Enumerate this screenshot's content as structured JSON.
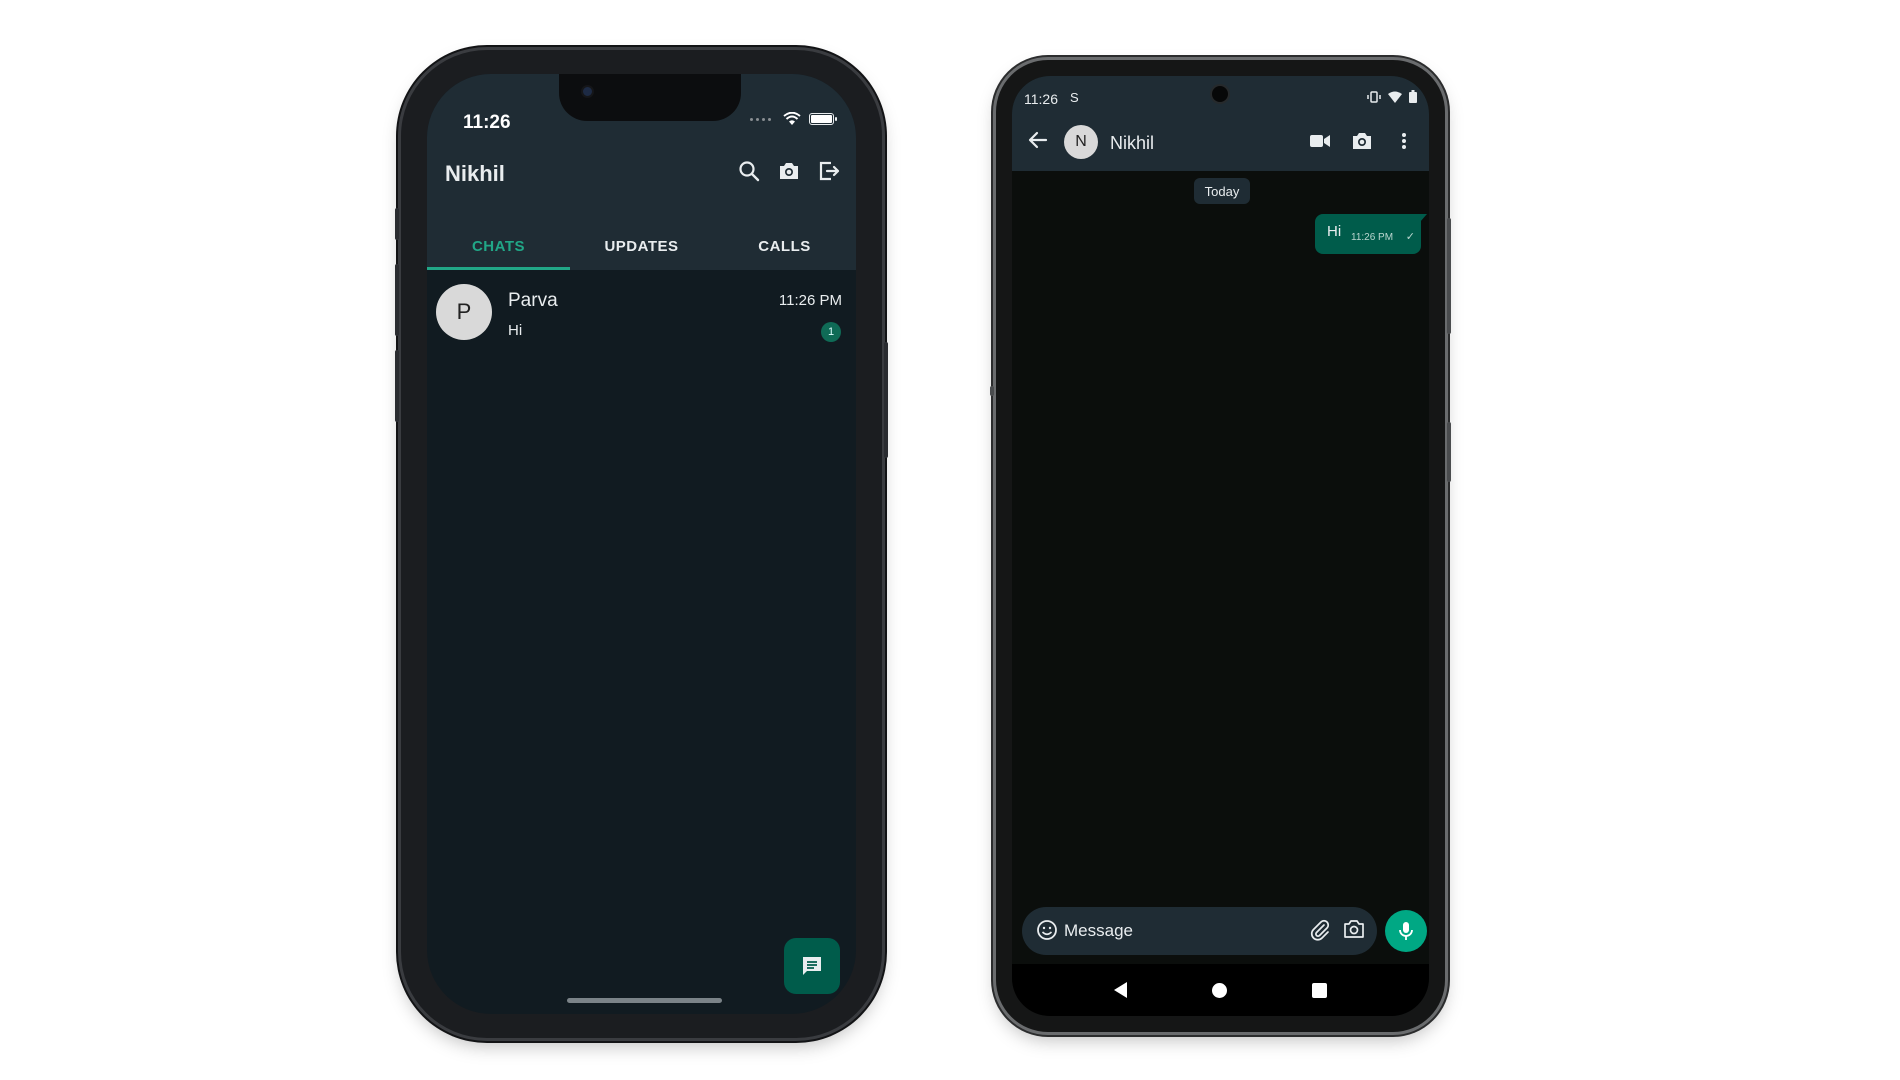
{
  "ios": {
    "status_time": "11:26",
    "title": "Nikhil",
    "tabs": [
      {
        "label": "CHATS"
      },
      {
        "label": "UPDATES"
      },
      {
        "label": "CALLS"
      }
    ],
    "chats": [
      {
        "avatar_letter": "P",
        "name": "Parva",
        "last_message": "Hi",
        "time": "11:26 PM",
        "unread": "1"
      }
    ],
    "icons": [
      "search-icon",
      "camera-icon",
      "logout-icon",
      "new-chat-icon"
    ]
  },
  "android": {
    "status_time": "11:26",
    "status_extra": "S",
    "contact_letter": "N",
    "contact_name": "Nikhil",
    "date_chip": "Today",
    "messages": [
      {
        "text": "Hi",
        "time": "11:26 PM",
        "status": "✓"
      }
    ],
    "input_placeholder": "Message",
    "icons": [
      "back-arrow-icon",
      "video-call-icon",
      "camera-icon",
      "more-vert-icon",
      "emoji-icon",
      "attach-icon",
      "mic-icon"
    ]
  },
  "colors": {
    "header_bg": "#1f2c34",
    "chat_bg": "#111b21",
    "accent": "#21a787",
    "bubble_out": "#005c4b",
    "mic_button": "#00a884"
  }
}
